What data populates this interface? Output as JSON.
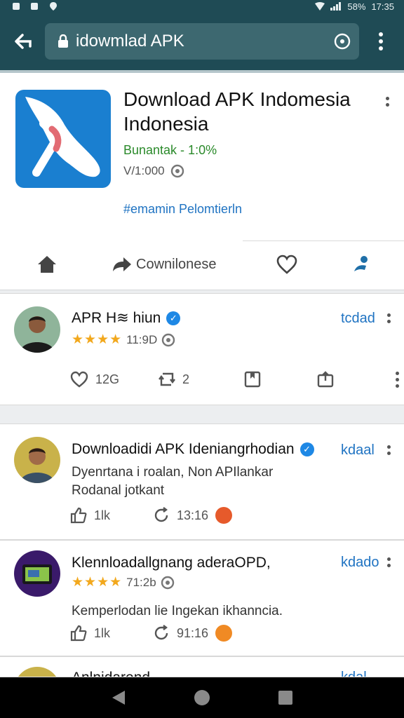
{
  "status_bar": {
    "battery": "58%",
    "time": "17:35"
  },
  "browser": {
    "url": "idowmlad APK"
  },
  "app_card": {
    "title": "Download APK Indomesia Indonesia",
    "subtitle": "Bunantak - 1:0%",
    "version": "V/1:000",
    "link": "#emamin Pelomtierln",
    "action_download": "Cownilonese"
  },
  "posts": [
    {
      "name": "APR H≋ hiun",
      "tag": "tcdad",
      "rating": "11:9D",
      "likes": "12G",
      "reposts": "2"
    },
    {
      "name": "Downloadidi APK Ideniangrhodian",
      "tag": "kdaal",
      "text_line1": "Dyenrtana i roalan, Non APIlankar",
      "text_line2": "Rodanal jotkant",
      "likes": "1lk",
      "time": "13:16"
    },
    {
      "name": "Klennloadallgnang aderaOPD,",
      "tag": "kdado",
      "rating": "71:2b",
      "text": "Kemperlodan lie Ingekan ikhanncia.",
      "likes": "1lk",
      "time": "91:16"
    },
    {
      "name": "Anlnidarend",
      "tag": "kdal"
    }
  ],
  "colors": {
    "toolbar": "#1f4b55",
    "url_field": "#3d6870",
    "accent": "#1f73c2",
    "app_icon": "#1a7fd0"
  }
}
